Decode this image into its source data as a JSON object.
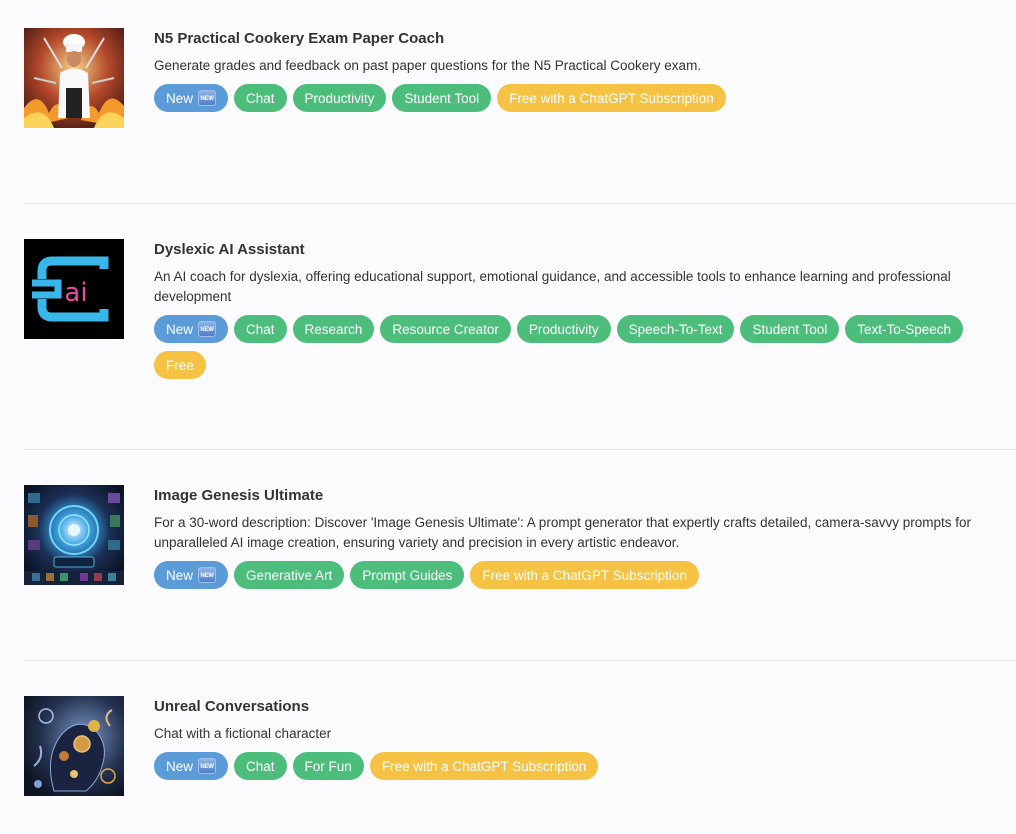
{
  "entries": [
    {
      "title": "N5 Practical Cookery Exam Paper Coach",
      "description": "Generate grades and feedback on past paper questions for the N5 Practical Cookery exam.",
      "tags": [
        {
          "label": "New",
          "color": "blue",
          "badge": "NEW"
        },
        {
          "label": "Chat",
          "color": "green"
        },
        {
          "label": "Productivity",
          "color": "green"
        },
        {
          "label": "Student Tool",
          "color": "green"
        },
        {
          "label": "Free with a ChatGPT Subscription",
          "color": "yellow"
        }
      ]
    },
    {
      "title": "Dyslexic AI Assistant",
      "description": "An AI coach for dyslexia, offering educational support, emotional guidance, and accessible tools to enhance learning and professional development",
      "logo_text": "ai",
      "tags": [
        {
          "label": "New",
          "color": "blue",
          "badge": "NEW"
        },
        {
          "label": "Chat",
          "color": "green"
        },
        {
          "label": "Research",
          "color": "green"
        },
        {
          "label": "Resource Creator",
          "color": "green"
        },
        {
          "label": "Productivity",
          "color": "green"
        },
        {
          "label": "Speech-To-Text",
          "color": "green"
        },
        {
          "label": "Student Tool",
          "color": "green"
        },
        {
          "label": "Text-To-Speech",
          "color": "green"
        },
        {
          "label": "Free",
          "color": "yellow"
        }
      ]
    },
    {
      "title": "Image Genesis Ultimate",
      "description": "For a 30-word description: Discover 'Image Genesis Ultimate': A prompt generator that expertly crafts detailed, camera-savvy prompts for unparalleled AI image creation, ensuring variety and precision in every artistic endeavor.",
      "tags": [
        {
          "label": "New",
          "color": "blue",
          "badge": "NEW"
        },
        {
          "label": "Generative Art",
          "color": "green"
        },
        {
          "label": "Prompt Guides",
          "color": "green"
        },
        {
          "label": "Free with a ChatGPT Subscription",
          "color": "yellow"
        }
      ]
    },
    {
      "title": "Unreal Conversations",
      "description": "Chat with a fictional character",
      "tags": [
        {
          "label": "New",
          "color": "blue",
          "badge": "NEW"
        },
        {
          "label": "Chat",
          "color": "green"
        },
        {
          "label": "For Fun",
          "color": "green"
        },
        {
          "label": "Free with a ChatGPT Subscription",
          "color": "yellow"
        }
      ]
    }
  ],
  "colors": {
    "tag_blue": "#5b9bd8",
    "tag_green": "#4dbd7c",
    "tag_yellow": "#f6c244",
    "divider": "#e6e6ea"
  }
}
